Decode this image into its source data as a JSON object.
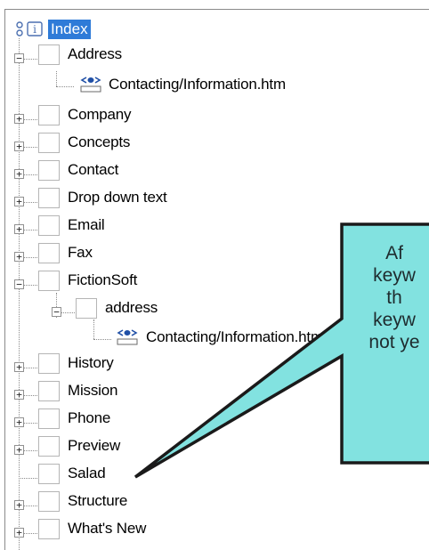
{
  "tree": {
    "root": {
      "label": "Index",
      "icon": "index-root-icon",
      "selected": true
    },
    "items": [
      {
        "label": "Address",
        "expander": "⊟"
      },
      {
        "label": "Contacting/Information.htm",
        "icon": "topic-link-icon"
      },
      {
        "label": "Company",
        "expander": "⊞"
      },
      {
        "label": "Concepts",
        "expander": "⊞"
      },
      {
        "label": "Contact",
        "expander": "⊞"
      },
      {
        "label": "Drop down text",
        "expander": "⊞"
      },
      {
        "label": "Email",
        "expander": "⊞"
      },
      {
        "label": "Fax",
        "expander": "⊞"
      },
      {
        "label": "FictionSoft",
        "expander": "⊟"
      },
      {
        "label": "address",
        "expander": "⊟"
      },
      {
        "label": "Contacting/Information.htm",
        "icon": "topic-link-icon"
      },
      {
        "label": "History",
        "expander": "⊞"
      },
      {
        "label": "Mission",
        "expander": "⊞"
      },
      {
        "label": "Phone",
        "expander": "⊞"
      },
      {
        "label": "Preview",
        "expander": "⊞"
      },
      {
        "label": "Salad"
      },
      {
        "label": "Structure",
        "expander": "⊞"
      },
      {
        "label": "What's New",
        "expander": "⊞"
      }
    ]
  },
  "callout": {
    "lines": [
      "Af",
      "keyw",
      "th",
      "keyw",
      "not ye"
    ],
    "fill": "#82e2e0",
    "stroke": "#1a1a1a"
  },
  "colors": {
    "selection": "#2f7bd8",
    "topic_icon": "#1f4fa6"
  }
}
